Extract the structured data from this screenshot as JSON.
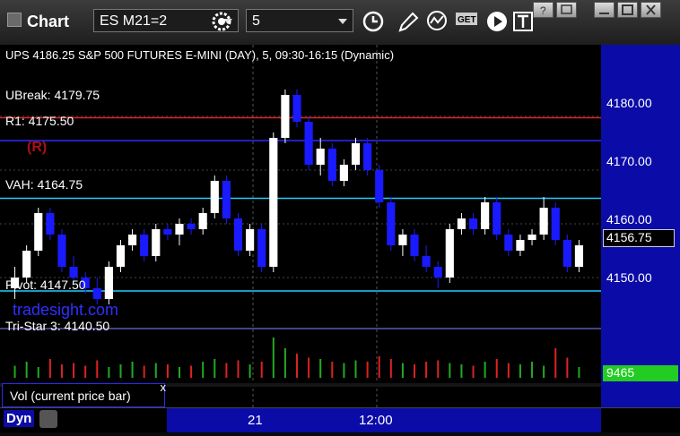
{
  "titlebar": {
    "title": "Chart",
    "symbol": "ES M21=2",
    "interval": "5",
    "menu_label": "GET"
  },
  "header_text": "UPS 4186.25 S&P 500 FUTURES E-MINI (DAY), 5, 09:30-16:15 (Dynamic)",
  "levels": {
    "ubreak": "UBreak: 4179.75",
    "r1": "R1: 4175.50",
    "vah": "VAH: 4164.75",
    "pivot": "Pivot: 4147.50",
    "tristar": "Tri-Star 3: 4140.50",
    "r_tag": "(R)"
  },
  "watermark": "tradesight.com",
  "price_axis": {
    "ticks": [
      "4180.00",
      "4170.00",
      "4160.00",
      "4150.00"
    ],
    "current": "4156.75"
  },
  "volume": {
    "current": "9465",
    "panel_label": "Vol (current price bar)",
    "close_label": "x"
  },
  "time_axis": [
    "21",
    "12:00"
  ],
  "footer": {
    "dyn_label": "Dyn"
  },
  "colors": {
    "up": "#ffffff",
    "down": "#1a1aff",
    "axis_bg": "#0b0ba8",
    "grid": "#444444",
    "cyan": "#22ccff",
    "red": "#dd2222",
    "green": "#22aa22"
  },
  "chart_data": {
    "type": "candlestick",
    "title": "S&P 500 FUTURES E-MINI (DAY), 5, 09:30-16:15 (Dynamic)",
    "ylim": [
      4140,
      4190
    ],
    "ohlc": [
      [
        4148,
        4152,
        4146,
        4150
      ],
      [
        4150,
        4156,
        4149,
        4155
      ],
      [
        4155,
        4163,
        4154,
        4162
      ],
      [
        4162,
        4163,
        4157,
        4158
      ],
      [
        4158,
        4159,
        4151,
        4152
      ],
      [
        4152,
        4154,
        4149,
        4150
      ],
      [
        4150,
        4151,
        4147,
        4148
      ],
      [
        4148,
        4150,
        4145,
        4146
      ],
      [
        4146,
        4153,
        4145,
        4152
      ],
      [
        4152,
        4157,
        4151,
        4156
      ],
      [
        4156,
        4159,
        4155,
        4158
      ],
      [
        4158,
        4159,
        4153,
        4154
      ],
      [
        4154,
        4160,
        4153,
        4159
      ],
      [
        4159,
        4160,
        4157,
        4158
      ],
      [
        4158,
        4161,
        4156,
        4160
      ],
      [
        4160,
        4161,
        4158,
        4159
      ],
      [
        4159,
        4163,
        4158,
        4162
      ],
      [
        4162,
        4169,
        4161,
        4168
      ],
      [
        4168,
        4169,
        4160,
        4161
      ],
      [
        4161,
        4162,
        4154,
        4155
      ],
      [
        4155,
        4160,
        4154,
        4159
      ],
      [
        4159,
        4160,
        4151,
        4152
      ],
      [
        4152,
        4177,
        4151,
        4176
      ],
      [
        4176,
        4185,
        4175,
        4184
      ],
      [
        4184,
        4185,
        4178,
        4179
      ],
      [
        4179,
        4180,
        4170,
        4171
      ],
      [
        4171,
        4176,
        4169,
        4174
      ],
      [
        4174,
        4175,
        4167,
        4168
      ],
      [
        4168,
        4172,
        4167,
        4171
      ],
      [
        4171,
        4176,
        4170,
        4175
      ],
      [
        4175,
        4176,
        4169,
        4170
      ],
      [
        4170,
        4171,
        4163,
        4164
      ],
      [
        4164,
        4165,
        4155,
        4156
      ],
      [
        4156,
        4159,
        4154,
        4158
      ],
      [
        4158,
        4159,
        4153,
        4154
      ],
      [
        4154,
        4156,
        4151,
        4152
      ],
      [
        4152,
        4153,
        4148,
        4150
      ],
      [
        4150,
        4160,
        4149,
        4159
      ],
      [
        4159,
        4162,
        4158,
        4161
      ],
      [
        4161,
        4162,
        4158,
        4159
      ],
      [
        4159,
        4165,
        4158,
        4164
      ],
      [
        4164,
        4165,
        4157,
        4158
      ],
      [
        4158,
        4159,
        4154,
        4155
      ],
      [
        4155,
        4158,
        4154,
        4157
      ],
      [
        4157,
        4159,
        4156,
        4158
      ],
      [
        4158,
        4165,
        4157,
        4163
      ],
      [
        4163,
        4164,
        4156,
        4157
      ],
      [
        4157,
        4158,
        4151,
        4152
      ],
      [
        4152,
        4157,
        4151,
        4156
      ]
    ],
    "volume": [
      9,
      12,
      8,
      14,
      10,
      11,
      9,
      13,
      8,
      10,
      12,
      9,
      11,
      10,
      8,
      9,
      12,
      14,
      11,
      13,
      10,
      12,
      30,
      22,
      18,
      15,
      14,
      12,
      11,
      13,
      12,
      16,
      14,
      11,
      10,
      12,
      13,
      11,
      10,
      9,
      12,
      14,
      11,
      10,
      12,
      9,
      22,
      15,
      8
    ],
    "levels": {
      "UBreak": 4179.75,
      "R1": 4175.5,
      "VAH": 4164.75,
      "Pivot": 4147.5,
      "Tri-Star 3": 4140.5
    }
  }
}
